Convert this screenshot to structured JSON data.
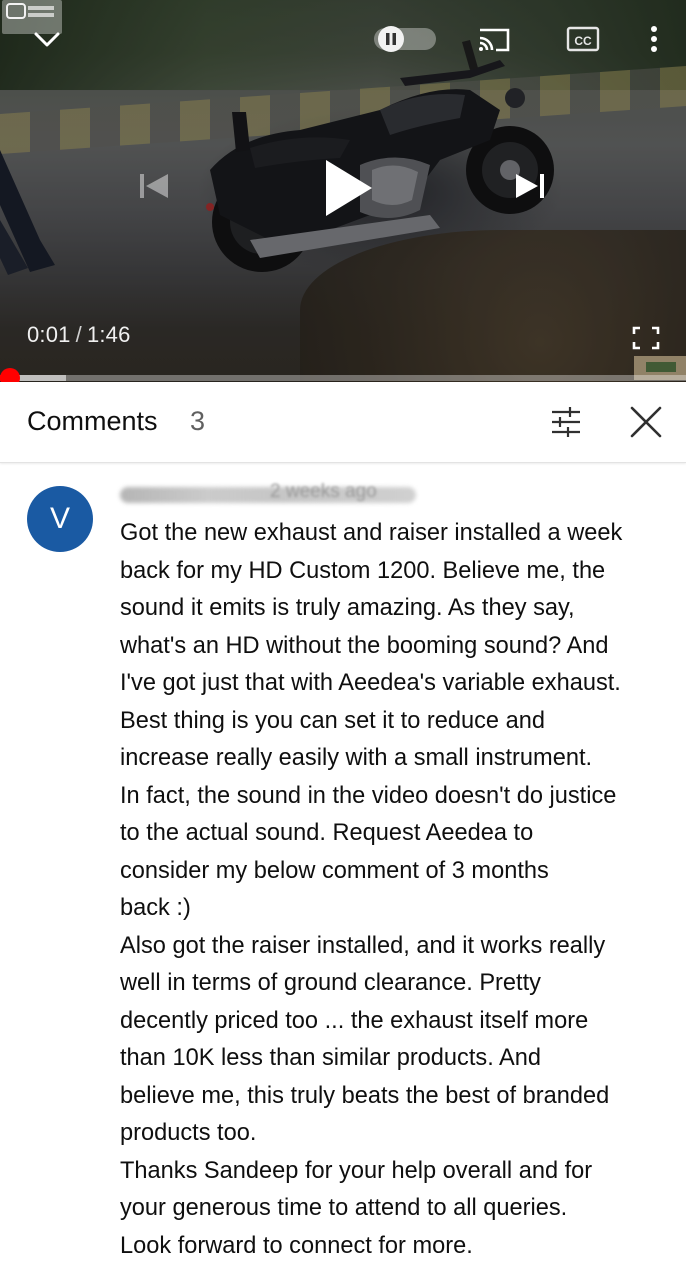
{
  "player": {
    "current_time": "0:01",
    "separator": "/",
    "duration": "1:46",
    "progress_fraction": 0.0094,
    "buffered_fraction": 0.096,
    "autoplay_on": true,
    "icons": {
      "minimize": "chevron-down-icon",
      "autoplay": "autoplay-toggle-icon",
      "cast": "cast-icon",
      "captions": "closed-captions-icon",
      "more": "more-vert-icon",
      "previous": "skip-previous-icon",
      "play": "play-icon",
      "next": "skip-next-icon",
      "fullscreen": "fullscreen-icon"
    },
    "captions_label": "CC",
    "accent_color": "#ff0000"
  },
  "comments": {
    "title": "Comments",
    "count": "3",
    "icons": {
      "sort": "sort-filter-icon",
      "close": "close-icon"
    }
  },
  "comment": {
    "avatar_initial": "V",
    "avatar_color": "#1a5aa3",
    "meta_visible": "2 weeks ago",
    "lines": [
      "Got the new exhaust and raiser installed a week",
      "back for my HD Custom 1200. Believe me, the",
      "sound it emits is truly amazing. As they say,",
      "what's an HD without the booming sound? And",
      "I've got just that with Aeedea's variable exhaust.",
      "Best thing is you can set it to reduce and",
      "increase really easily with a small instrument.",
      "In fact, the sound in the video doesn't do justice",
      "to the actual sound. Request Aeedea to",
      "consider my below comment of 3 months",
      "back :)",
      "Also got the raiser installed, and it works really",
      "well in terms of ground clearance. Pretty",
      "decently priced too ... the exhaust itself more",
      "than 10K less than similar products. And",
      "believe me, this truly beats the best of branded",
      "products too.",
      "Thanks  Sandeep for your help overall and for",
      "your generous time to attend to all queries.",
      "Look forward to connect for more."
    ]
  }
}
